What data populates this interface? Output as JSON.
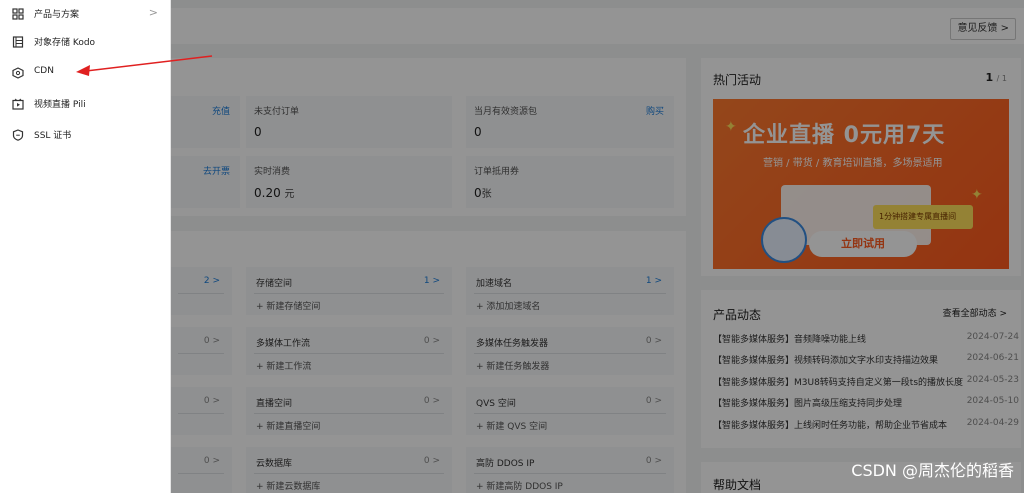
{
  "topbar": {
    "feedback_label": "意见反馈 >"
  },
  "account": {
    "row1": [
      {
        "label": "",
        "value": "",
        "link": "充值"
      },
      {
        "label": "未支付订单",
        "value": "0",
        "unit": "",
        "link": ""
      },
      {
        "label": "当月有效资源包",
        "value": "0",
        "unit": "",
        "link": "购买"
      }
    ],
    "row2": [
      {
        "label": "",
        "value": "",
        "link": "去开票"
      },
      {
        "label": "实时消费",
        "value": "0.20",
        "unit": "元",
        "link": ""
      },
      {
        "label": "订单抵用券",
        "value": "0",
        "unit": "张",
        "link": ""
      }
    ]
  },
  "services": {
    "col1": [
      {
        "count": "2 >",
        "highlight": true
      },
      {
        "count": "0 >",
        "highlight": false
      },
      {
        "count": "0 >",
        "highlight": false
      },
      {
        "count": "0 >",
        "highlight": false
      }
    ],
    "col2": [
      {
        "name": "存储空间",
        "count": "1 >",
        "highlight": true,
        "add": "+ 新建存储空间"
      },
      {
        "name": "多媒体工作流",
        "count": "0 >",
        "highlight": false,
        "add": "+ 新建工作流"
      },
      {
        "name": "直播空间",
        "count": "0 >",
        "highlight": false,
        "add": "+ 新建直播空间"
      },
      {
        "name": "云数据库",
        "count": "0 >",
        "highlight": false,
        "add": "+ 新建云数据库"
      }
    ],
    "col3": [
      {
        "name": "加速域名",
        "count": "1 >",
        "highlight": true,
        "add": "+ 添加加速域名"
      },
      {
        "name": "多媒体任务触发器",
        "count": "0 >",
        "highlight": false,
        "add": "+ 新建任务触发器"
      },
      {
        "name": "QVS 空间",
        "count": "0 >",
        "highlight": false,
        "add": "+ 新建 QVS 空间"
      },
      {
        "name": "高防 DDOS IP",
        "count": "0 >",
        "highlight": false,
        "add": "+ 新建高防 DDOS IP"
      }
    ]
  },
  "hot": {
    "title": "热门活动",
    "page_current": "1",
    "page_total": "/ 1",
    "banner_title": "企业直播 0元用7天",
    "banner_sub": "营销 / 带货 / 教育培训直播，多场景适用",
    "banner_tag": "1分钟搭建专属直播间",
    "banner_cta": "立即试用"
  },
  "news": {
    "title": "产品动态",
    "view_all": "查看全部动态 >",
    "items": [
      {
        "text": "【智能多媒体服务】音频降噪功能上线",
        "date": "2024-07-24"
      },
      {
        "text": "【智能多媒体服务】视频转码添加文字水印支持描边效果",
        "date": "2024-06-21"
      },
      {
        "text": "【智能多媒体服务】M3U8转码支持自定义第一段ts的播放长度",
        "date": "2024-05-23"
      },
      {
        "text": "【智能多媒体服务】图片高级压缩支持同步处理",
        "date": "2024-05-10"
      },
      {
        "text": "【智能多媒体服务】上线闲时任务功能，帮助企业节省成本",
        "date": "2024-04-29"
      }
    ]
  },
  "docs": {
    "title": "帮助文档"
  },
  "menu": {
    "items": [
      {
        "label": "产品与方案",
        "icon": "grid-icon",
        "chevron": ">"
      },
      {
        "label": "对象存储 Kodo",
        "icon": "storage-icon"
      },
      {
        "label": "CDN",
        "icon": "cdn-icon"
      },
      {
        "label": "视频直播 Pili",
        "icon": "live-icon"
      },
      {
        "label": "SSL 证书",
        "icon": "shield-icon"
      }
    ]
  },
  "annotation": {
    "arrow_color": "#e02020"
  },
  "watermark": "CSDN @周杰伦的稻香"
}
